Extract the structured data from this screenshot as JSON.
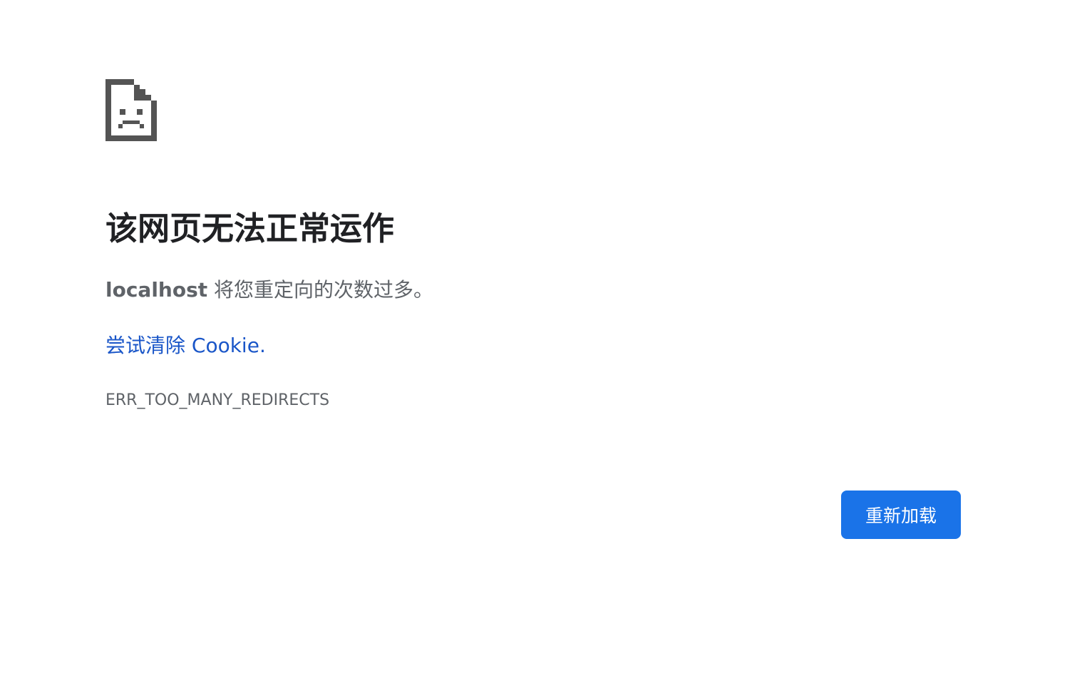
{
  "error_page": {
    "icon": "sad-document-icon",
    "title": "该网页无法正常运作",
    "host": "localhost",
    "summary_rest": " 将您重定向的次数过多。",
    "suggestion_link": "尝试清除 Cookie",
    "suggestion_suffix": ".",
    "error_code": "ERR_TOO_MANY_REDIRECTS",
    "reload_label": "重新加载"
  },
  "colors": {
    "title": "#202124",
    "body_text": "#5f6368",
    "link": "#1a56c8",
    "button": "#1a73e8",
    "icon": "#545454"
  }
}
